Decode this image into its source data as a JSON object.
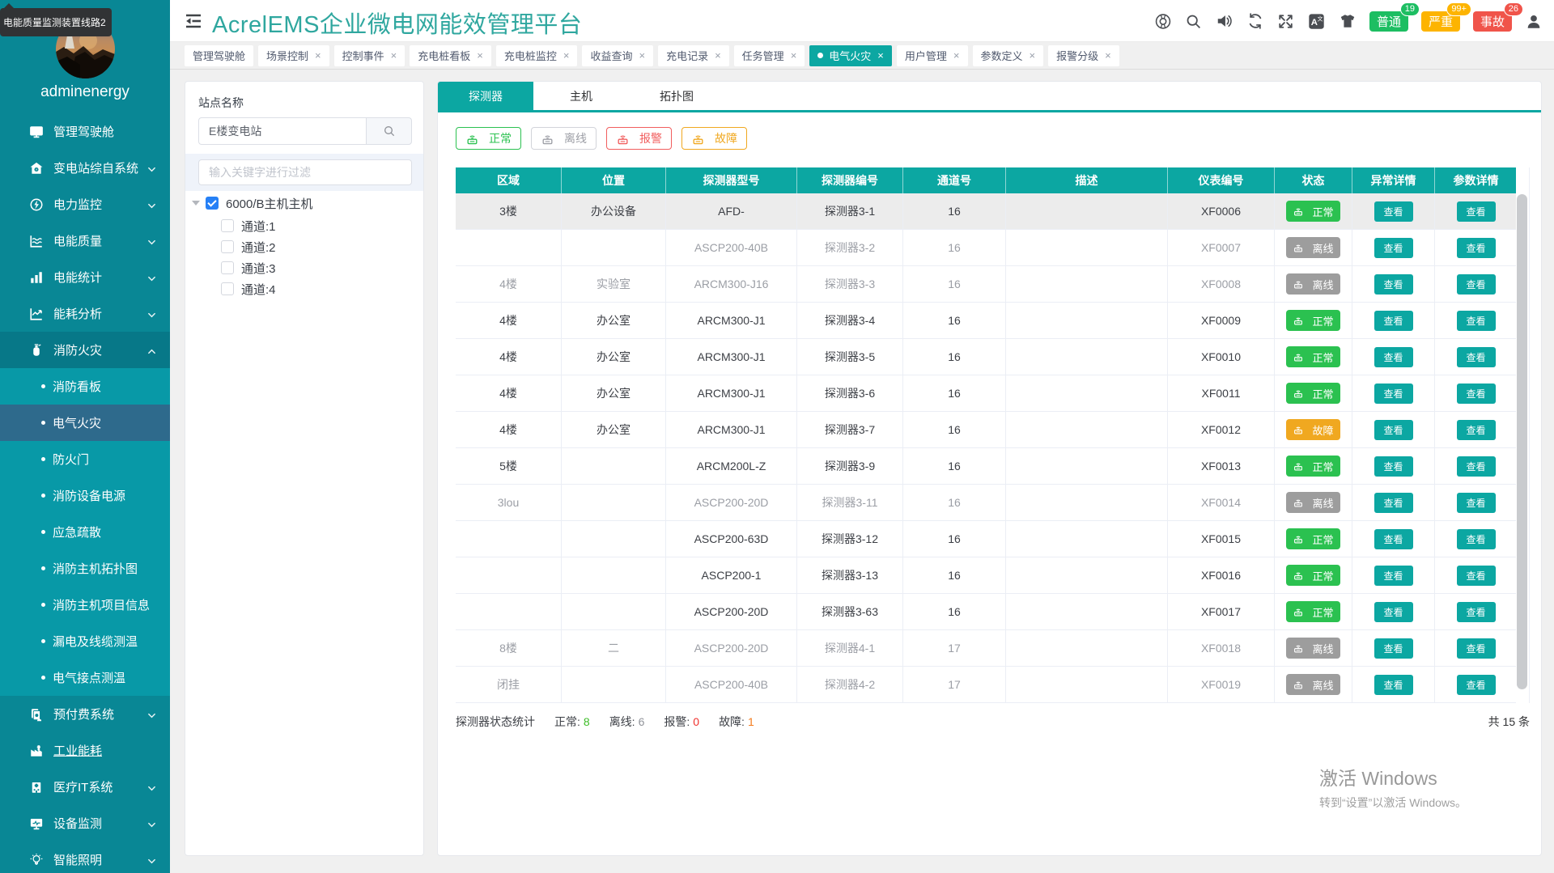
{
  "colors": {
    "brand_teal": "#0ca7a2",
    "sidebar": "#098795",
    "sidebar_submenu": "#0899a7",
    "sidebar_selected": "#2e6a8c",
    "status_normal": "#2bc150",
    "status_offline": "#9d9d9d",
    "status_alarm": "#f15e5e",
    "status_fault": "#f0a820",
    "alarm_common": "#1dbe62",
    "alarm_severe": "#fdb400",
    "alarm_accident": "#f0544a"
  },
  "tooltip": {
    "text": "电能质量监测装置线路2"
  },
  "sidebar": {
    "username": "adminenergy",
    "items": [
      {
        "label": "管理驾驶舱",
        "icon": "dashboard-icon",
        "chevron": false
      },
      {
        "label": "变电站综自系统",
        "icon": "substation-icon",
        "chevron": true
      },
      {
        "label": "电力监控",
        "icon": "power-monitor-icon",
        "chevron": true
      },
      {
        "label": "电能质量",
        "icon": "power-quality-icon",
        "chevron": true
      },
      {
        "label": "电能统计",
        "icon": "energy-stats-icon",
        "chevron": true
      },
      {
        "label": "能耗分析",
        "icon": "energy-analysis-icon",
        "chevron": true
      },
      {
        "label": "消防火灾",
        "icon": "fire-icon",
        "chevron": true,
        "expanded": true,
        "children": [
          "消防看板",
          "电气火灾",
          "防火门",
          "消防设备电源",
          "应急疏散",
          "消防主机拓扑图",
          "消防主机项目信息",
          "漏电及线缆测温",
          "电气接点测温"
        ],
        "selected_child": "电气火灾"
      },
      {
        "label": "预付费系统",
        "icon": "prepaid-icon",
        "chevron": true
      },
      {
        "label": "工业能耗",
        "icon": "industry-icon",
        "chevron": false,
        "underline": true
      },
      {
        "label": "医疗IT系统",
        "icon": "medical-icon",
        "chevron": true
      },
      {
        "label": "设备监测",
        "icon": "device-monitor-icon",
        "chevron": true
      },
      {
        "label": "智能照明",
        "icon": "lighting-icon",
        "chevron": true
      }
    ]
  },
  "header": {
    "title": "AcrelEMS企业微电网能效管理平台",
    "icons": [
      "help-icon",
      "search-icon",
      "sound-icon",
      "refresh-icon",
      "fullscreen-icon",
      "translate-icon",
      "theme-icon"
    ],
    "alarm_buttons": [
      {
        "label": "普通",
        "count": "19",
        "kind": "normal"
      },
      {
        "label": "严重",
        "count": "99+",
        "kind": "severe"
      },
      {
        "label": "事故",
        "count": "26",
        "kind": "accident"
      }
    ],
    "user_icon": "user-icon"
  },
  "tabbar": {
    "tabs": [
      {
        "label": "管理驾驶舱",
        "closable": false,
        "active": false
      },
      {
        "label": "场景控制",
        "closable": true,
        "active": false
      },
      {
        "label": "控制事件",
        "closable": true,
        "active": false
      },
      {
        "label": "充电桩看板",
        "closable": true,
        "active": false
      },
      {
        "label": "充电桩监控",
        "closable": true,
        "active": false
      },
      {
        "label": "收益查询",
        "closable": true,
        "active": false
      },
      {
        "label": "充电记录",
        "closable": true,
        "active": false
      },
      {
        "label": "任务管理",
        "closable": true,
        "active": false
      },
      {
        "label": "电气火灾",
        "closable": true,
        "active": true
      },
      {
        "label": "用户管理",
        "closable": true,
        "active": false
      },
      {
        "label": "参数定义",
        "closable": true,
        "active": false
      },
      {
        "label": "报警分级",
        "closable": true,
        "active": false
      }
    ]
  },
  "station_panel": {
    "label": "站点名称",
    "search_value": "E楼变电站",
    "filter_placeholder": "输入关键字进行过滤",
    "tree": {
      "root": "6000/B主机主机",
      "root_checked": true,
      "children": [
        "通道:1",
        "通道:2",
        "通道:3",
        "通道:4"
      ]
    }
  },
  "main": {
    "tabs": [
      {
        "label": "探测器",
        "active": true
      },
      {
        "label": "主机",
        "active": false
      },
      {
        "label": "拓扑图",
        "active": false
      }
    ],
    "legend": [
      {
        "label": "正常",
        "color": "#2bc150"
      },
      {
        "label": "离线",
        "color": "#9d9fa6",
        "border": "#d2d4da"
      },
      {
        "label": "报警",
        "color": "#f15e5e"
      },
      {
        "label": "故障",
        "color": "#f0a820"
      }
    ],
    "table": {
      "columns": [
        "区域",
        "位置",
        "探测器型号",
        "探测器编号",
        "通道号",
        "描述",
        "仪表编号",
        "状态",
        "异常详情",
        "参数详情"
      ],
      "view_label": "查看",
      "status_labels": {
        "normal": "正常",
        "offline": "离线",
        "fault": "故障"
      },
      "rows": [
        {
          "area": "3楼",
          "location": "办公设备",
          "model": "AFD-",
          "code": "探测器3-1",
          "channel": "16",
          "desc": "",
          "meter": "XF0006",
          "status": "normal",
          "selected": true
        },
        {
          "area": "",
          "location": "",
          "model": "ASCP200-40B",
          "code": "探测器3-2",
          "channel": "16",
          "desc": "",
          "meter": "XF0007",
          "status": "offline"
        },
        {
          "area": "4楼",
          "location": "实验室",
          "model": "ARCM300-J16",
          "code": "探测器3-3",
          "channel": "16",
          "desc": "",
          "meter": "XF0008",
          "status": "offline"
        },
        {
          "area": "4楼",
          "location": "办公室",
          "model": "ARCM300-J1",
          "code": "探测器3-4",
          "channel": "16",
          "desc": "",
          "meter": "XF0009",
          "status": "normal"
        },
        {
          "area": "4楼",
          "location": "办公室",
          "model": "ARCM300-J1",
          "code": "探测器3-5",
          "channel": "16",
          "desc": "",
          "meter": "XF0010",
          "status": "normal"
        },
        {
          "area": "4楼",
          "location": "办公室",
          "model": "ARCM300-J1",
          "code": "探测器3-6",
          "channel": "16",
          "desc": "",
          "meter": "XF0011",
          "status": "normal"
        },
        {
          "area": "4楼",
          "location": "办公室",
          "model": "ARCM300-J1",
          "code": "探测器3-7",
          "channel": "16",
          "desc": "",
          "meter": "XF0012",
          "status": "fault"
        },
        {
          "area": "5楼",
          "location": "",
          "model": "ARCM200L-Z",
          "code": "探测器3-9",
          "channel": "16",
          "desc": "",
          "meter": "XF0013",
          "status": "normal"
        },
        {
          "area": "3lou",
          "location": "",
          "model": "ASCP200-20D",
          "code": "探测器3-11",
          "channel": "16",
          "desc": "",
          "meter": "XF0014",
          "status": "offline"
        },
        {
          "area": "",
          "location": "",
          "model": "ASCP200-63D",
          "code": "探测器3-12",
          "channel": "16",
          "desc": "",
          "meter": "XF0015",
          "status": "normal"
        },
        {
          "area": "",
          "location": "",
          "model": "ASCP200-1",
          "code": "探测器3-13",
          "channel": "16",
          "desc": "",
          "meter": "XF0016",
          "status": "normal"
        },
        {
          "area": "",
          "location": "",
          "model": "ASCP200-20D",
          "code": "探测器3-63",
          "channel": "16",
          "desc": "",
          "meter": "XF0017",
          "status": "normal"
        },
        {
          "area": "8楼",
          "location": "二",
          "model": "ASCP200-20D",
          "code": "探测器4-1",
          "channel": "17",
          "desc": "",
          "meter": "XF0018",
          "status": "offline"
        },
        {
          "area": "闭挂",
          "location": "",
          "model": "ASCP200-40B",
          "code": "探测器4-2",
          "channel": "17",
          "desc": "",
          "meter": "XF0019",
          "status": "offline"
        }
      ]
    },
    "stats": {
      "label": "探测器状态统计",
      "normal_label": "正常:",
      "normal_value": "8",
      "offline_label": "离线:",
      "offline_value": "6",
      "alarm_label": "报警:",
      "alarm_value": "0",
      "fault_label": "故障:",
      "fault_value": "1"
    },
    "total": "共 15 条"
  },
  "watermark": {
    "line1": "激活 Windows",
    "line2": "转到“设置”以激活 Windows。"
  }
}
